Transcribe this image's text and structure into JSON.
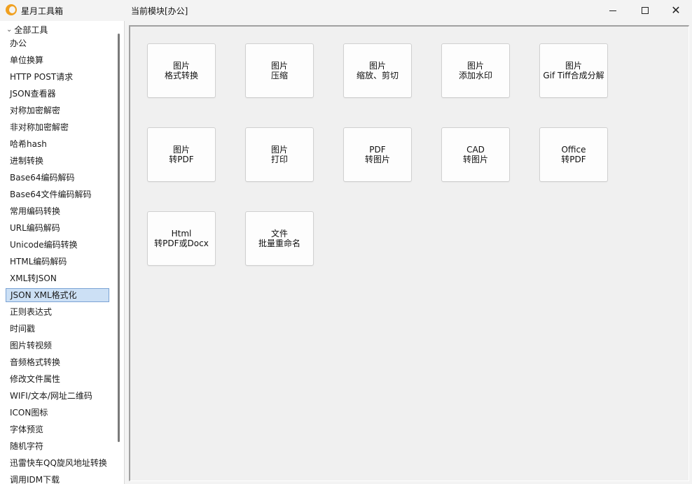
{
  "app": {
    "title": "星月工具箱",
    "module_title": "当前模块[办公]",
    "controls": {
      "minimize": "—",
      "maximize": "□",
      "close": "✕"
    }
  },
  "sidebar": {
    "root_label": "全部工具",
    "items": [
      "办公",
      "单位换算",
      "HTTP POST请求",
      "JSON查看器",
      "对称加密解密",
      "非对称加密解密",
      "哈希hash",
      "进制转换",
      "Base64编码解码",
      "Base64文件编码解码",
      "常用编码转换",
      "URL编码解码",
      "Unicode编码转换",
      "HTML编码解码",
      "XML转JSON",
      "JSON XML格式化",
      "正则表达式",
      "时间戳",
      "图片转视频",
      "音频格式转换",
      "修改文件属性",
      "WIFI/文本/网址二维码",
      "ICON图标",
      "字体预览",
      "随机字符",
      "迅雷快车QQ旋风地址转换",
      "调用IDM下载"
    ],
    "selected_index": 15
  },
  "tools": [
    {
      "line1": "图片",
      "line2": "格式转换"
    },
    {
      "line1": "图片",
      "line2": "压缩"
    },
    {
      "line1": "图片",
      "line2": "缩放、剪切"
    },
    {
      "line1": "图片",
      "line2": "添加水印"
    },
    {
      "line1": "图片",
      "line2": "Gif Tiff合成分解"
    },
    {
      "line1": "图片",
      "line2": "转PDF"
    },
    {
      "line1": "图片",
      "line2": "打印"
    },
    {
      "line1": "PDF",
      "line2": "转图片"
    },
    {
      "line1": "CAD",
      "line2": "转图片"
    },
    {
      "line1": "Office",
      "line2": "转PDF"
    },
    {
      "line1": "Html",
      "line2": "转PDF或Docx"
    },
    {
      "line1": "文件",
      "line2": "批量重命名"
    }
  ]
}
